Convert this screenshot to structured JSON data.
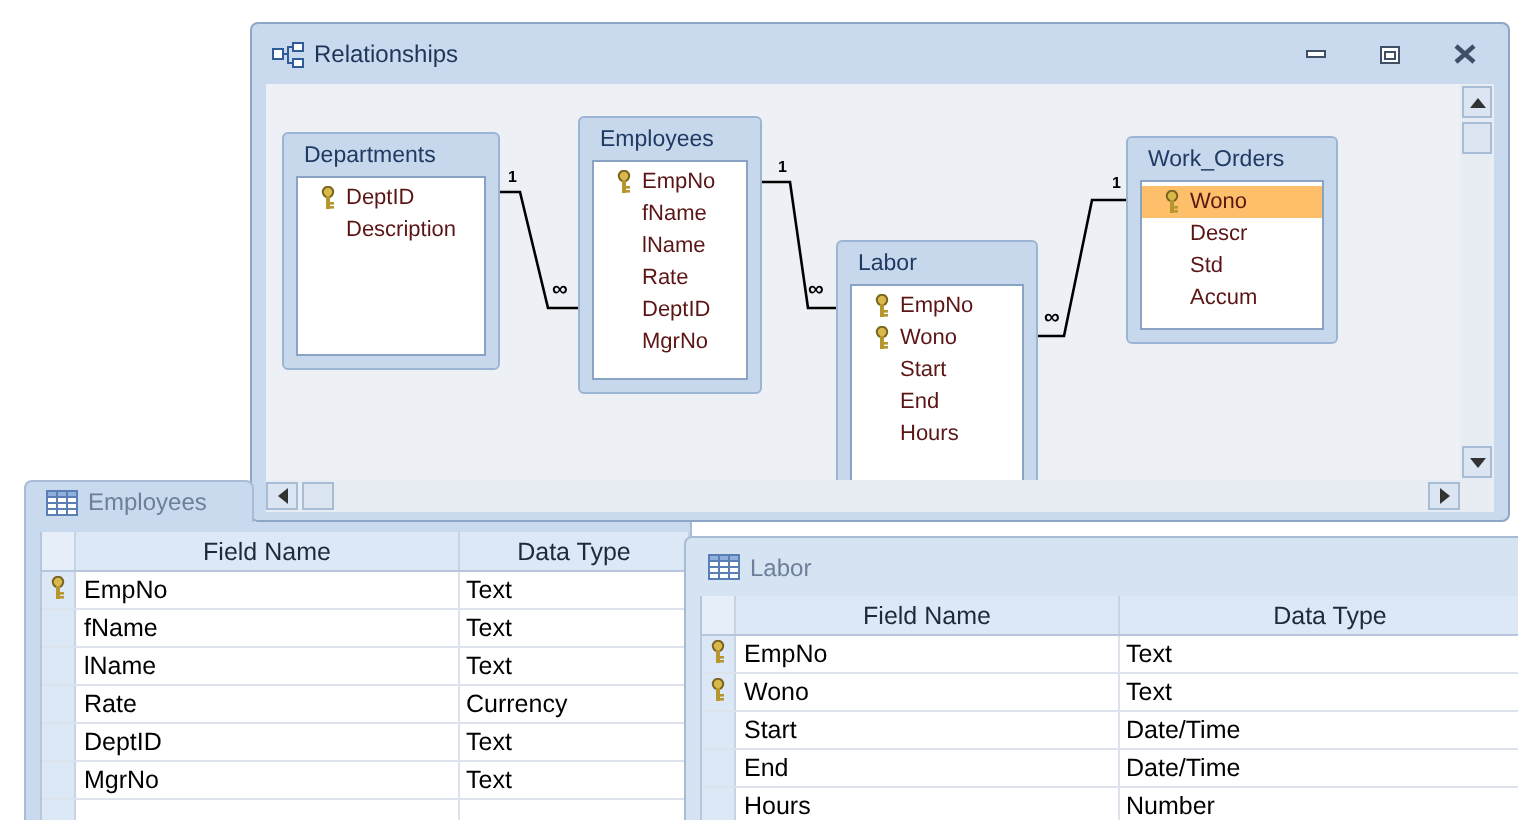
{
  "relationships_window": {
    "title": "Relationships",
    "tables": [
      {
        "name": "Departments",
        "fields": [
          {
            "name": "DeptID",
            "key": true,
            "selected": false
          },
          {
            "name": "Description",
            "key": false,
            "selected": false
          }
        ]
      },
      {
        "name": "Employees",
        "fields": [
          {
            "name": "EmpNo",
            "key": true,
            "selected": false
          },
          {
            "name": "fName",
            "key": false,
            "selected": false
          },
          {
            "name": "lName",
            "key": false,
            "selected": false
          },
          {
            "name": "Rate",
            "key": false,
            "selected": false
          },
          {
            "name": "DeptID",
            "key": false,
            "selected": false
          },
          {
            "name": "MgrNo",
            "key": false,
            "selected": false
          }
        ]
      },
      {
        "name": "Labor",
        "fields": [
          {
            "name": "EmpNo",
            "key": true,
            "selected": false
          },
          {
            "name": "Wono",
            "key": true,
            "selected": false
          },
          {
            "name": "Start",
            "key": false,
            "selected": false
          },
          {
            "name": "End",
            "key": false,
            "selected": false
          },
          {
            "name": "Hours",
            "key": false,
            "selected": false
          }
        ]
      },
      {
        "name": "Work_Orders",
        "fields": [
          {
            "name": "Wono",
            "key": true,
            "selected": true
          },
          {
            "name": "Descr",
            "key": false,
            "selected": false
          },
          {
            "name": "Std",
            "key": false,
            "selected": false
          },
          {
            "name": "Accum",
            "key": false,
            "selected": false
          }
        ]
      }
    ],
    "relationships": [
      {
        "one_label": "1",
        "many_label": "∞"
      },
      {
        "one_label": "1",
        "many_label": "∞"
      },
      {
        "one_label": "1",
        "many_label": "∞"
      }
    ]
  },
  "design_windows": [
    {
      "title": "Employees",
      "columns": [
        "Field Name",
        "Data Type"
      ],
      "rows": [
        {
          "field": "EmpNo",
          "type": "Text",
          "key": true
        },
        {
          "field": "fName",
          "type": "Text",
          "key": false
        },
        {
          "field": "lName",
          "type": "Text",
          "key": false
        },
        {
          "field": "Rate",
          "type": "Currency",
          "key": false
        },
        {
          "field": "DeptID",
          "type": "Text",
          "key": false
        },
        {
          "field": "MgrNo",
          "type": "Text",
          "key": false
        }
      ]
    },
    {
      "title": "Labor",
      "columns": [
        "Field Name",
        "Data Type"
      ],
      "rows": [
        {
          "field": "EmpNo",
          "type": "Text",
          "key": true
        },
        {
          "field": "Wono",
          "type": "Text",
          "key": true
        },
        {
          "field": "Start",
          "type": "Date/Time",
          "key": false
        },
        {
          "field": "End",
          "type": "Date/Time",
          "key": false
        },
        {
          "field": "Hours",
          "type": "Number",
          "key": false
        }
      ]
    }
  ]
}
